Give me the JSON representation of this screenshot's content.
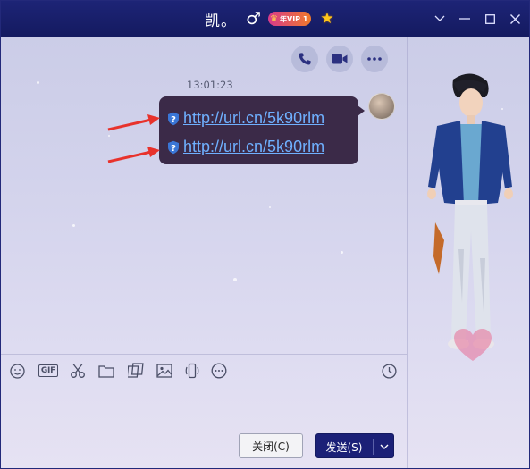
{
  "window": {
    "contact_name": "凯。",
    "gender_icon": "male-symbol-icon",
    "gender_glyph": "♂",
    "vip_badge": "年VIP 1",
    "star_glyph": "★",
    "controls": [
      "chevron-down-icon",
      "minimize-icon",
      "maximize-icon",
      "close-icon"
    ]
  },
  "toolbar": {
    "buttons": [
      "phone-icon",
      "video-call-icon",
      "more-icon"
    ]
  },
  "chat": {
    "timestamp": "13:01:23",
    "messages": [
      {
        "type": "link",
        "text": "http://url.cn/5k90rlm",
        "icon": "security-shield-question-icon"
      },
      {
        "type": "link",
        "text": "http://url.cn/5k90rlm",
        "icon": "security-shield-question-icon"
      }
    ]
  },
  "input_toolbar": {
    "icons": [
      "emoji-icon",
      "gif-icon",
      "scissors-icon",
      "folder-icon",
      "image-gallery-icon",
      "image-icon",
      "shake-icon",
      "more-icon",
      "history-clock-icon"
    ],
    "gif_label": "GIF"
  },
  "buttons": {
    "close_label": "关闭(C)",
    "send_label": "发送(S)"
  },
  "colors": {
    "titlebar": "#1d2476",
    "bubble": "#3b2a48",
    "link": "#6fb0ff",
    "send_button": "#1b2077",
    "annotation_arrow": "#e8322c"
  }
}
